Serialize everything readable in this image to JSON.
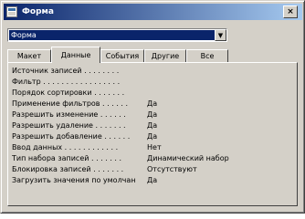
{
  "window": {
    "title": "Форма",
    "close_label": "×"
  },
  "object_selector": {
    "value": "Форма",
    "arrow_label": "▼"
  },
  "tabs": [
    {
      "label": "Макет"
    },
    {
      "label": "Данные"
    },
    {
      "label": "События"
    },
    {
      "label": "Другие"
    },
    {
      "label": "Все"
    }
  ],
  "properties": [
    {
      "name": "Источник записей . . . . . . . .",
      "value": ""
    },
    {
      "name": "Фильтр . . . . . . . . . . . . . . . . .",
      "value": ""
    },
    {
      "name": "Порядок сортировки . . . . . . .",
      "value": ""
    },
    {
      "name": "Применение фильтров . . . . . .",
      "value": "Да"
    },
    {
      "name": "Разрешить изменение . . . . . .",
      "value": "Да"
    },
    {
      "name": "Разрешить удаление . . . . . . .",
      "value": "Да"
    },
    {
      "name": "Разрешить добавление . . . . . .",
      "value": "Да"
    },
    {
      "name": "Ввод данных . . . . . . . . . . . .",
      "value": "Нет"
    },
    {
      "name": "Тип набора записей . . . . . . .",
      "value": "Динамический набор"
    },
    {
      "name": "Блокировка записей . . . . . . .",
      "value": "Отсутствуют"
    },
    {
      "name": "Загрузить значения по умолчан",
      "value": "Да"
    }
  ]
}
